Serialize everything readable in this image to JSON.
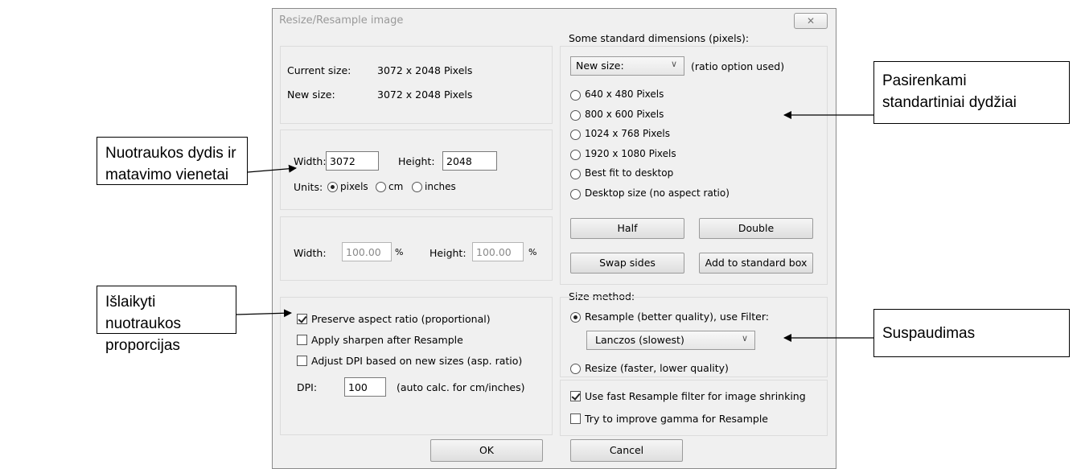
{
  "dialog": {
    "title": "Resize/Resample image",
    "close_glyph": "✕",
    "current_size_label": "Current size:",
    "current_size_value": "3072  x  2048  Pixels",
    "new_size_label": "New size:",
    "new_size_value": "3072  x  2048  Pixels",
    "width_label": "Width:",
    "width_value": "3072",
    "height_label": "Height:",
    "height_value": "2048",
    "units_label": "Units:",
    "units": [
      "pixels",
      "cm",
      "inches"
    ],
    "units_selected": "pixels",
    "pct_width_label": "Width:",
    "pct_width_value": "100.00",
    "pct_height_label": "Height:",
    "pct_height_value": "100.00",
    "pct_sign": "%",
    "preserve_label": "Preserve aspect ratio (proportional)",
    "preserve_checked": true,
    "sharpen_label": "Apply sharpen after Resample",
    "adjust_dpi_label": "Adjust DPI based on new sizes (asp. ratio)",
    "dpi_label": "DPI:",
    "dpi_value": "100",
    "dpi_note": "(auto calc. for cm/inches)",
    "std_header": "Some standard dimensions (pixels):",
    "std_combo_value": "New size:",
    "std_combo_note": "(ratio option used)",
    "std_options": [
      "640 x 480 Pixels",
      "800 x 600 Pixels",
      "1024 x 768 Pixels",
      "1920 x 1080 Pixels",
      "Best fit to desktop",
      "Desktop size (no aspect ratio)"
    ],
    "half_label": "Half",
    "double_label": "Double",
    "swap_label": "Swap sides",
    "add_std_label": "Add to standard box",
    "size_method_header": "Size method:",
    "resample_label": "Resample (better quality), use Filter:",
    "filter_value": "Lanczos (slowest)",
    "resize_label": "Resize (faster, lower quality)",
    "fast_resample_label": "Use fast Resample filter for image shrinking",
    "fast_resample_checked": true,
    "gamma_label": "Try to improve gamma for Resample",
    "ok_label": "OK",
    "cancel_label": "Cancel"
  },
  "callouts": {
    "size_units": [
      "Nuotraukos dydis ir",
      "matavimo vienetai"
    ],
    "aspect": [
      "Išlaikyti nuotraukos",
      "proporcijas"
    ],
    "standard": [
      "Pasirenkami",
      "standartiniai dydžiai"
    ],
    "compression": [
      "Suspaudimas"
    ]
  }
}
